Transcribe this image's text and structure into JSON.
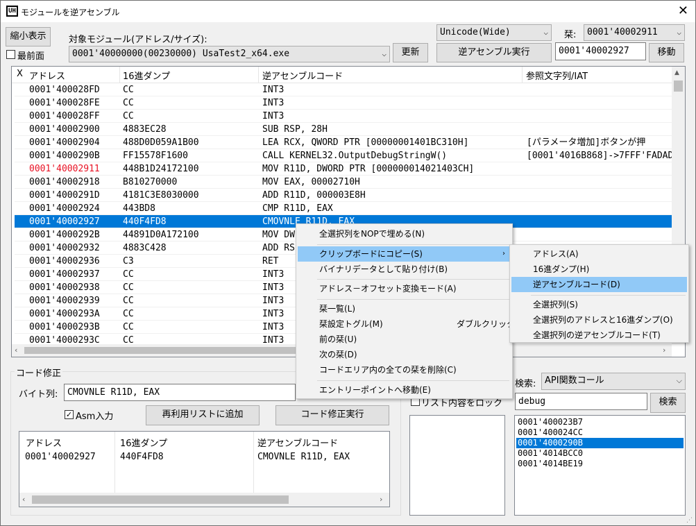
{
  "window": {
    "title": "モジュールを逆アセンブル",
    "icon_text": "UH",
    "close": "✕"
  },
  "toolbar": {
    "shrink_button": "縮小表示",
    "topmost_label": "最前面",
    "target_label": "対象モジュール(アドレス/サイズ):",
    "module_value": "0001'40000000(00230000) UsaTest2_x64.exe",
    "refresh_button": "更新",
    "encoding_value": "Unicode(Wide)",
    "bookmark_label": "栞:",
    "bookmark_value": "0001'40002911",
    "disasm_button": "逆アセンブル実行",
    "address_value": "0001'40002927",
    "move_button": "移動"
  },
  "columns": [
    "X",
    "アドレス",
    "16進ダンプ",
    "逆アセンブルコード",
    "参照文字列/IAT"
  ],
  "rows": [
    {
      "addr": "0001'400028FD",
      "hex": "CC",
      "asm": "INT3",
      "ref": ""
    },
    {
      "addr": "0001'400028FE",
      "hex": "CC",
      "asm": "INT3",
      "ref": ""
    },
    {
      "addr": "0001'400028FF",
      "hex": "CC",
      "asm": "INT3",
      "ref": ""
    },
    {
      "addr": "0001'40002900",
      "hex": "4883EC28",
      "asm": "SUB RSP, 28H",
      "ref": ""
    },
    {
      "addr": "0001'40002904",
      "hex": "488D0D059A1B00",
      "asm": "LEA RCX, QWORD PTR [00000001401BC310H]",
      "ref": "[パラメータ増加]ボタンが押"
    },
    {
      "addr": "0001'4000290B",
      "hex": "FF15578F1600",
      "asm": "CALL KERNEL32.OutputDebugStringW()",
      "ref": "[0001'4016B868]->7FFF'FADAD"
    },
    {
      "addr": "0001'40002911",
      "hex": "448B1D24172100",
      "asm": "MOV R11D, DWORD PTR [000000014021403CH]",
      "ref": ""
    },
    {
      "addr": "0001'40002918",
      "hex": "B810270000",
      "asm": "MOV EAX, 00002710H",
      "ref": ""
    },
    {
      "addr": "0001'4000291D",
      "hex": "4181C3E8030000",
      "asm": "ADD R11D, 000003E8H",
      "ref": ""
    },
    {
      "addr": "0001'40002924",
      "hex": "443BD8",
      "asm": "CMP R11D, EAX",
      "ref": ""
    },
    {
      "addr": "0001'40002927",
      "hex": "440F4FD8",
      "asm": "CMOVNLE R11D, EAX",
      "ref": ""
    },
    {
      "addr": "0001'4000292B",
      "hex": "44891D0A172100",
      "asm": "MOV DW",
      "ref": ""
    },
    {
      "addr": "0001'40002932",
      "hex": "4883C428",
      "asm": "ADD RS",
      "ref": ""
    },
    {
      "addr": "0001'40002936",
      "hex": "C3",
      "asm": "RET",
      "ref": ""
    },
    {
      "addr": "0001'40002937",
      "hex": "CC",
      "asm": "INT3",
      "ref": ""
    },
    {
      "addr": "0001'40002938",
      "hex": "CC",
      "asm": "INT3",
      "ref": ""
    },
    {
      "addr": "0001'40002939",
      "hex": "CC",
      "asm": "INT3",
      "ref": ""
    },
    {
      "addr": "0001'4000293A",
      "hex": "CC",
      "asm": "INT3",
      "ref": ""
    },
    {
      "addr": "0001'4000293B",
      "hex": "CC",
      "asm": "INT3",
      "ref": ""
    },
    {
      "addr": "0001'4000293C",
      "hex": "CC",
      "asm": "INT3",
      "ref": ""
    }
  ],
  "code_edit": {
    "group_title": "コード修正",
    "bytes_label": "バイト列:",
    "bytes_value": "CMOVNLE R11D, EAX",
    "asm_checkbox": "Asm入力",
    "add_button": "再利用リストに追加",
    "exec_button": "コード修正実行",
    "columns": [
      "アドレス",
      "16進ダンプ",
      "逆アセンブルコード"
    ],
    "row": {
      "addr": "0001'40002927",
      "hex": "440F4FD8",
      "asm": "CMOVNLE R11D, EAX"
    }
  },
  "search": {
    "lock_label": "リスト内容をロック",
    "search_label": "検索:",
    "mode_value": "API関数コール",
    "query_value": "debug",
    "search_button": "検索",
    "results": [
      "0001'400023B7",
      "0001'400024CC",
      "0001'4000290B",
      "0001'4014BCC0",
      "0001'4014BE19"
    ]
  },
  "context_menu": {
    "items": [
      "全選択列をNOPで埋める(N)",
      "クリップボードにコピー(S)",
      "バイナリデータとして貼り付け(B)",
      "アドレス－オフセット変換モード(A)",
      "栞一覧(L)",
      "栞設定トグル(M)",
      "前の栞(U)",
      "次の栞(D)",
      "コードエリア内の全ての栞を削除(C)",
      "エントリーポイントへ移動(E)"
    ],
    "bookmark_toggle_shortcut": "ダブルクリック",
    "submenu_arrow": "›"
  },
  "submenu": {
    "items": [
      "アドレス(A)",
      "16進ダンプ(H)",
      "逆アセンブルコード(D)",
      "全選択列(S)",
      "全選択列のアドレスと16進ダンプ(O)",
      "全選択列の逆アセンブルコード(T)"
    ]
  },
  "colors": {
    "selection": "#0078d7",
    "bookmark_red": "#e81123",
    "menu_highlight": "#91c9f7"
  }
}
